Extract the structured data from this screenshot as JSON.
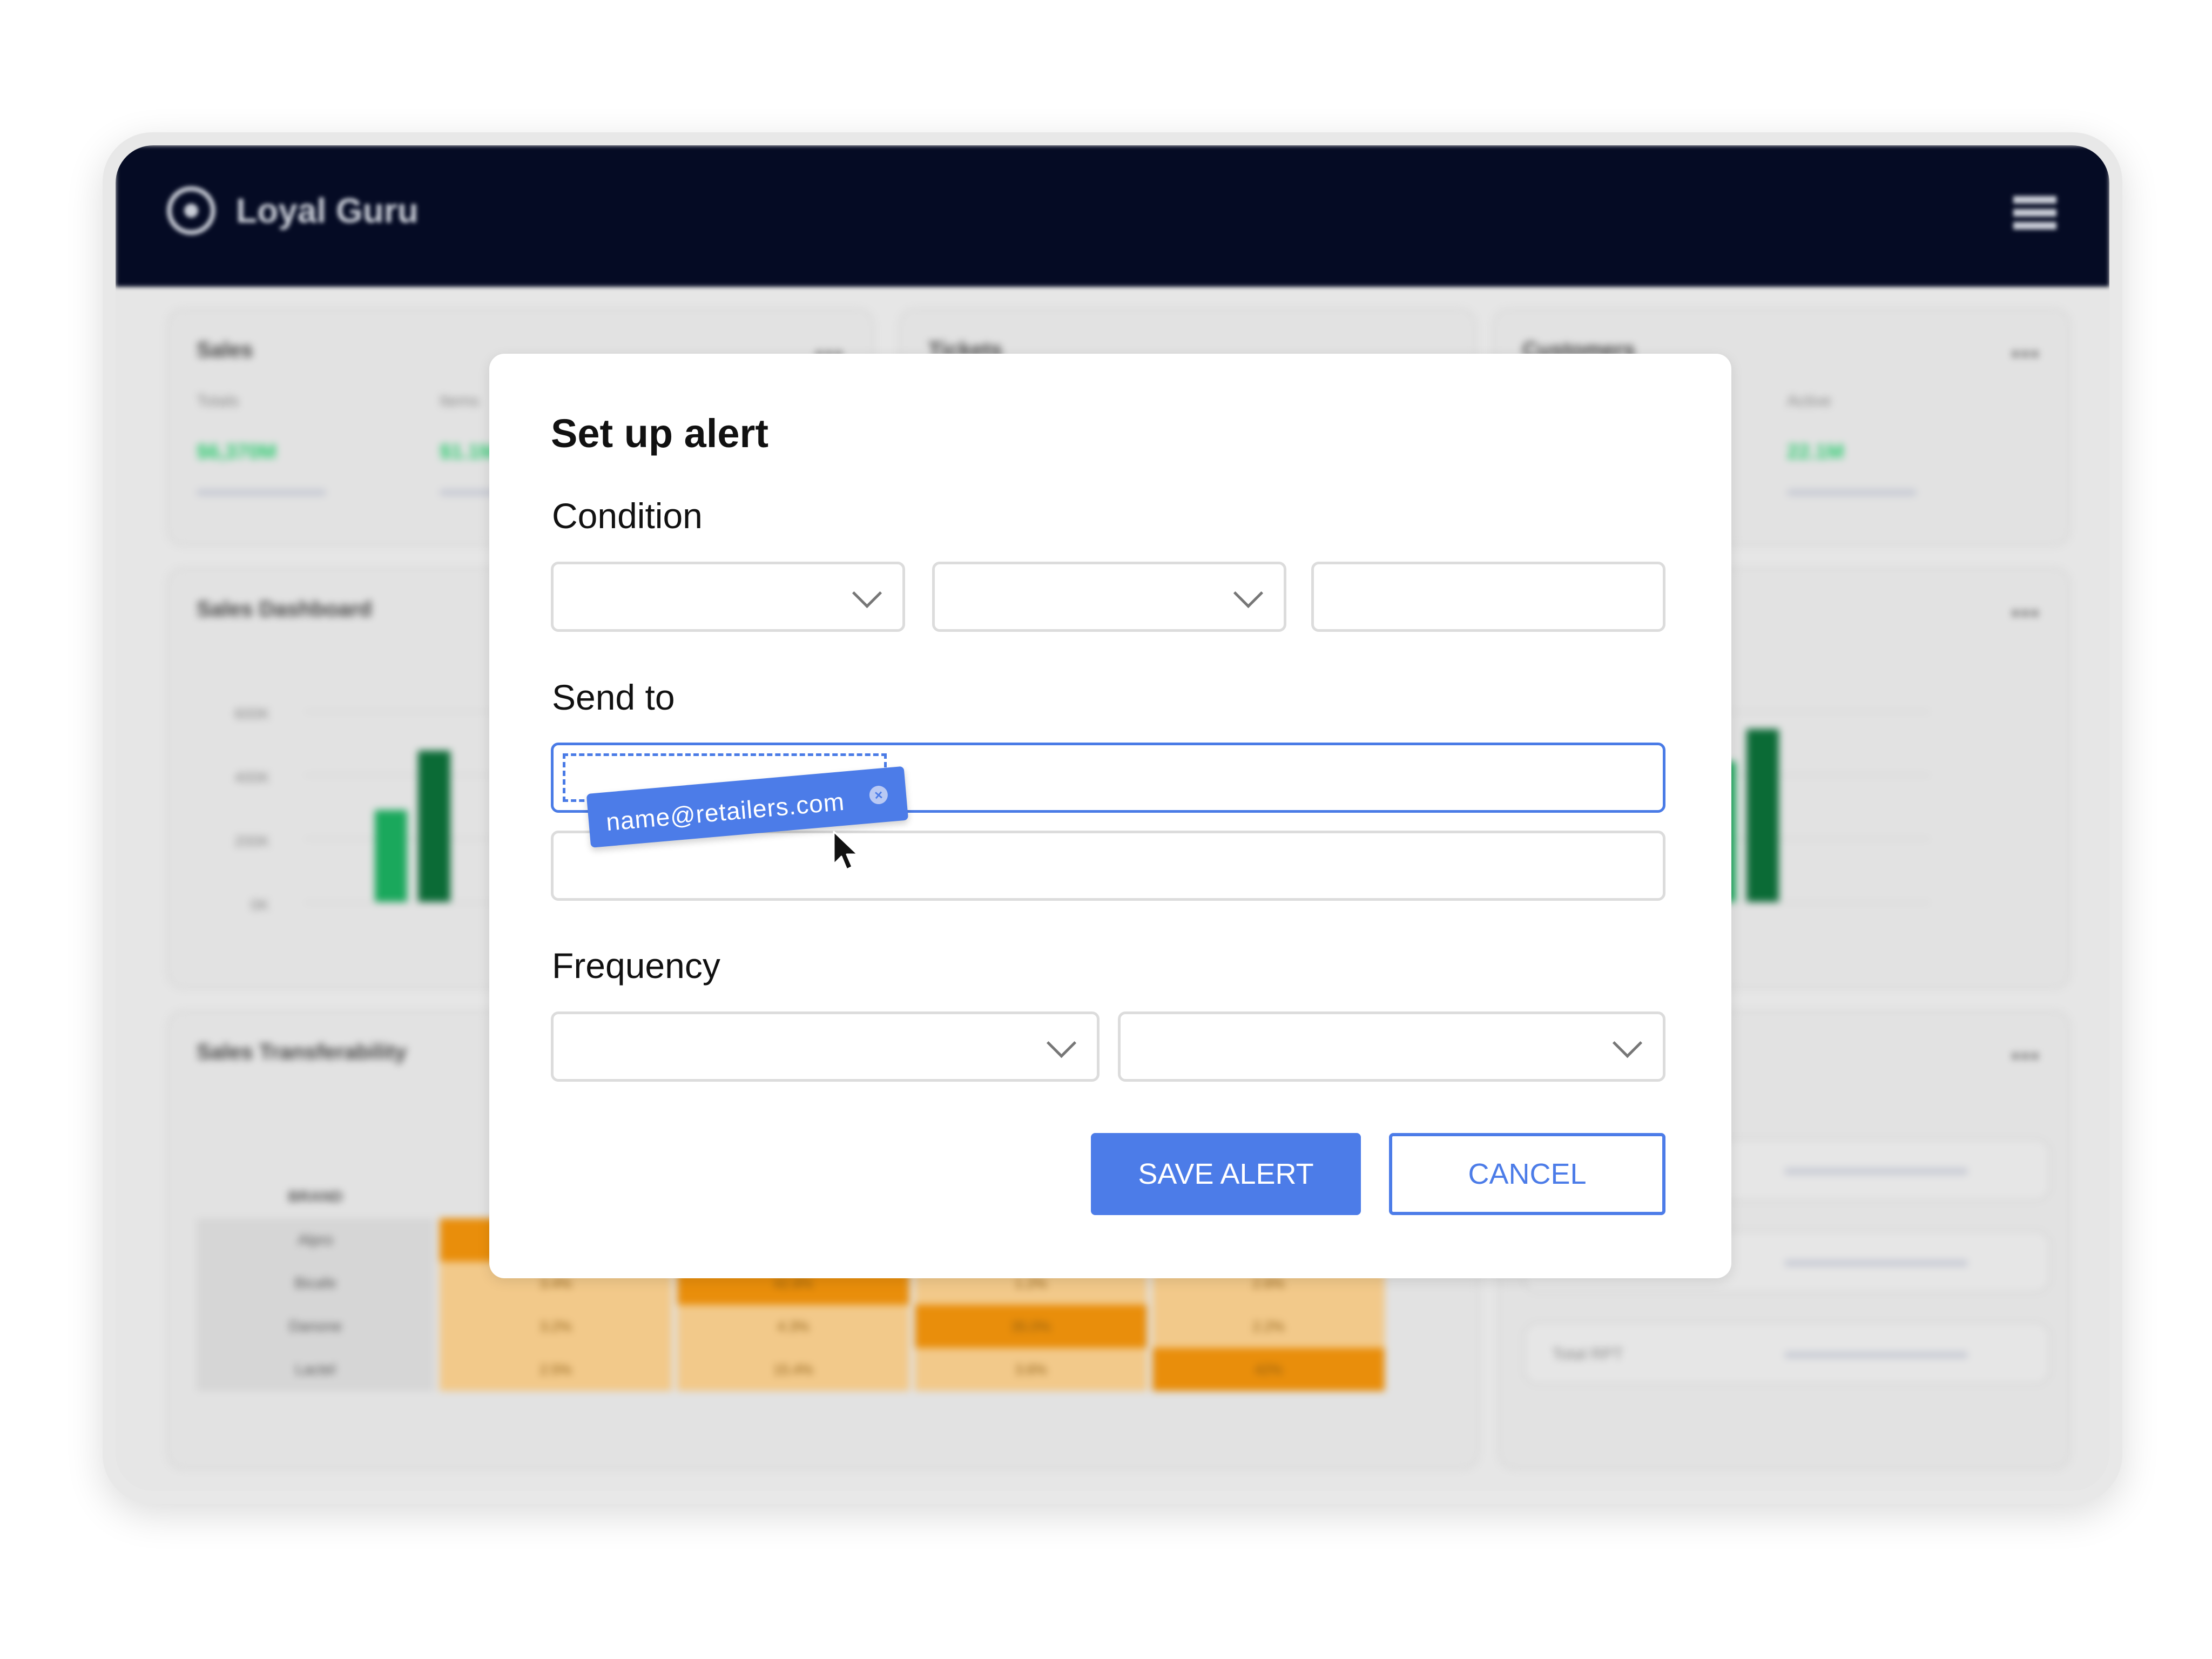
{
  "app": {
    "name": "Loyal Guru"
  },
  "background": {
    "cards": [
      {
        "title": "Sales",
        "label1": "Totals",
        "label2": "Items",
        "value1": "$6,370M",
        "value2": "$1.1M"
      },
      {
        "title": "Tickets"
      },
      {
        "title": "Customers",
        "label1": "Active",
        "value1": "22.1M"
      },
      {
        "title": "Sales Dashboard",
        "ticks": [
          "600K",
          "400K",
          "200K",
          "0K"
        ]
      },
      {
        "title": "Sales Transferability",
        "header": "BRAND",
        "rows": [
          "Alpro",
          "Bicafe",
          "Danone",
          "Lactel"
        ],
        "cells": [
          [
            "",
            "3.4%",
            "42.8%",
            "1.2%",
            "2.6%"
          ],
          [
            "",
            "3.2%",
            "4.3%",
            "35.0%",
            "2.2%"
          ],
          [
            "",
            "2.5%",
            "15.4%",
            "3.6%",
            "42%"
          ]
        ]
      },
      {
        "label": "Total RPT"
      }
    ]
  },
  "modal": {
    "title": "Set up alert",
    "condition_label": "Condition",
    "send_to_label": "Send to",
    "frequency_label": "Frequency",
    "chip_email": "name@retailers.com",
    "chip_close": "×",
    "save_button": "SAVE ALERT",
    "cancel_button": "CANCEL"
  },
  "colors": {
    "accent": "#4c7ce8",
    "header_bg": "#050b24",
    "green_light": "#1aa85c",
    "green_dark": "#0b6b36",
    "heat_light": "#f2c98a",
    "heat_dark": "#e98e0b"
  }
}
